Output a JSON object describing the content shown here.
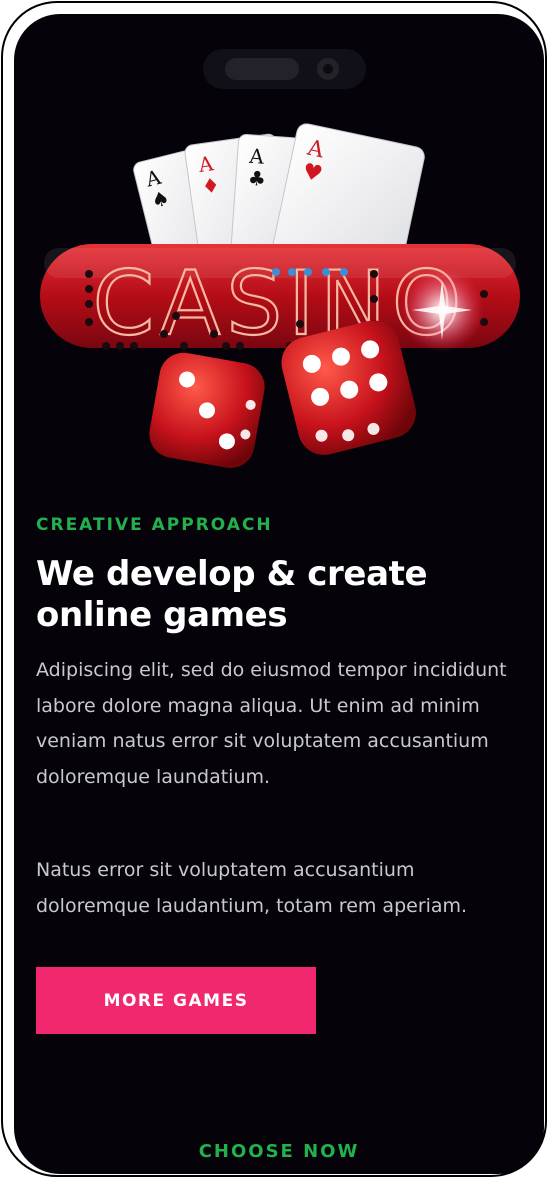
{
  "hero": {
    "logo_text": "CASINO",
    "card_suits": [
      "spade",
      "diamond",
      "club",
      "heart"
    ],
    "card_rank": "A",
    "colors": {
      "sign_red": "#c8101a",
      "dice_red": "#d11820",
      "card_white": "#f2f2f4"
    }
  },
  "section": {
    "eyebrow": "CREATIVE APPROACH",
    "title": "We develop & create online games",
    "paragraph1": "Adipiscing elit, sed do eiusmod tempor incididunt labore dolore magna aliqua. Ut enim ad minim veniam natus error sit voluptatem accusantium doloremque laundatium.",
    "paragraph2": "Natus error sit voluptatem accusantium doloremque laudantium, totam rem aperiam.",
    "button_label": "MORE GAMES",
    "choose_label": "CHOOSE NOW"
  },
  "theme": {
    "background": "#050309",
    "accent_green": "#22b14c",
    "accent_pink": "#f2286f"
  }
}
